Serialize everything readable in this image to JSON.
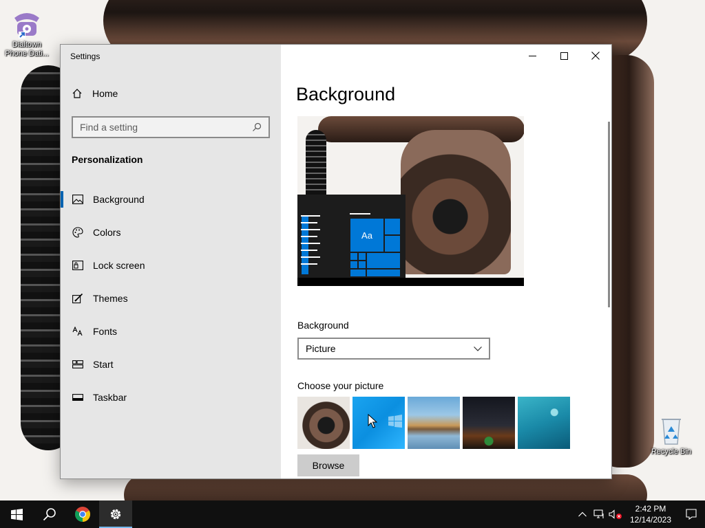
{
  "desktop": {
    "icons": [
      {
        "label": "Dialtown Phone Dati...",
        "icon": "phone-app-icon"
      },
      {
        "label": "Recycle Bin",
        "icon": "recycle-bin-icon"
      }
    ]
  },
  "window": {
    "title": "Settings",
    "controls": [
      "minimize-icon",
      "maximize-icon",
      "close-icon"
    ]
  },
  "sidebar": {
    "home_label": "Home",
    "search_placeholder": "Find a setting",
    "section_heading": "Personalization",
    "items": [
      {
        "label": "Background",
        "icon": "picture-icon",
        "active": true
      },
      {
        "label": "Colors",
        "icon": "palette-icon",
        "active": false
      },
      {
        "label": "Lock screen",
        "icon": "lock-screen-icon",
        "active": false
      },
      {
        "label": "Themes",
        "icon": "themes-brush-icon",
        "active": false
      },
      {
        "label": "Fonts",
        "icon": "fonts-icon",
        "active": false
      },
      {
        "label": "Start",
        "icon": "start-menu-icon",
        "active": false
      },
      {
        "label": "Taskbar",
        "icon": "taskbar-icon",
        "active": false
      }
    ]
  },
  "content": {
    "title": "Background",
    "preview_tile_label": "Aa",
    "background_label": "Background",
    "background_value": "Picture",
    "choose_label": "Choose your picture",
    "thumbnails": [
      "vintage-phone",
      "windows-blue",
      "beach-rock",
      "night-sky-tent",
      "underwater-swimmer"
    ],
    "browse_label": "Browse"
  },
  "taskbar": {
    "apps": [
      "windows-start-icon",
      "search-icon",
      "chrome-icon",
      "settings-gear-icon"
    ],
    "active_app": "settings-gear-icon",
    "time": "2:42 PM",
    "date": "12/14/2023"
  },
  "colors": {
    "accent": "#0078d7",
    "sidebar_bg": "#e6e6e6",
    "taskbar_bg": "#101010"
  }
}
